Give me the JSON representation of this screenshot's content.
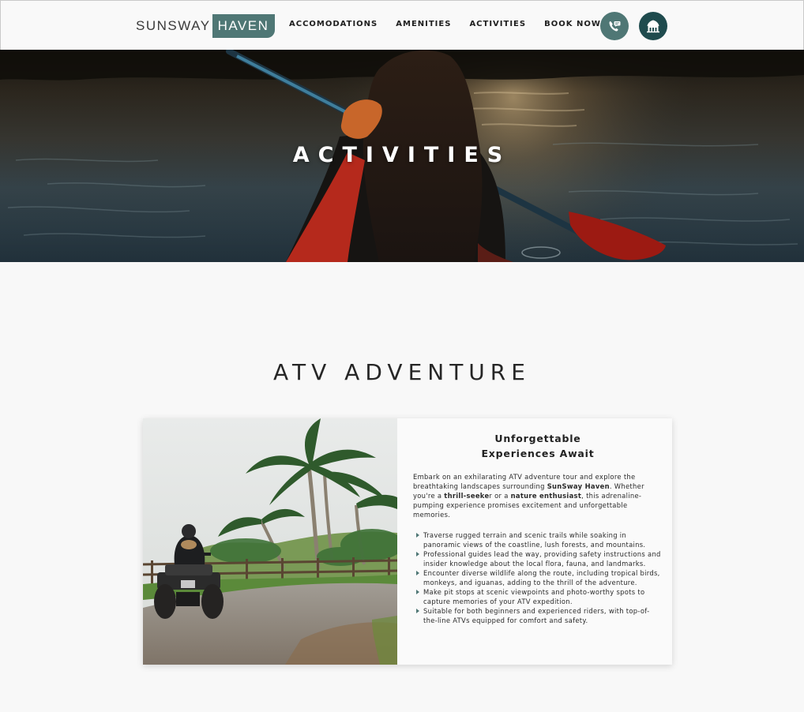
{
  "brand": {
    "name_light": "SUNSWAY",
    "name_box": "HAVEN"
  },
  "nav": {
    "items": [
      "ACCOMODATIONS",
      "AMENITIES",
      "ACTIVITIES",
      "BOOK NOW"
    ]
  },
  "icons": {
    "contact": "phone-chat-icon",
    "home": "home-icon"
  },
  "colors": {
    "accent": "#4f7775",
    "accent_dark": "#1f4b4e",
    "paddle_red": "#a8180f"
  },
  "hero": {
    "title": "ACTIVITIES"
  },
  "section": {
    "title": "ATV ADVENTURE"
  },
  "card": {
    "heading_line1": "Unforgettable",
    "heading_line2": "Experiences Await",
    "intro": {
      "p1": "Embark on an exhilarating ATV adventure tour and explore the breathtaking landscapes surrounding ",
      "brand": "SunSway Haven",
      "p2": ". Whether you're a ",
      "thrill_bold": "thrill-seeke",
      "thrill_rest": "r or a ",
      "nature": "nature enthusiast",
      "p3": ", this adrenaline-pumping experience promises excitement and unforgettable memories."
    },
    "bullets": [
      "Traverse rugged terrain and scenic trails while soaking in panoramic views of the coastline, lush forests, and mountains.",
      "Professional guides lead the way, providing safety instructions and insider knowledge about the local flora, fauna, and landmarks.",
      "Encounter diverse wildlife along the route, including tropical birds, monkeys, and iguanas, adding to the thrill of the adventure.",
      "Make pit stops at scenic viewpoints and photo-worthy spots to capture memories of your ATV expedition.",
      "Suitable for both beginners and experienced riders, with top-of-the-line ATVs equipped for comfort and safety."
    ]
  }
}
